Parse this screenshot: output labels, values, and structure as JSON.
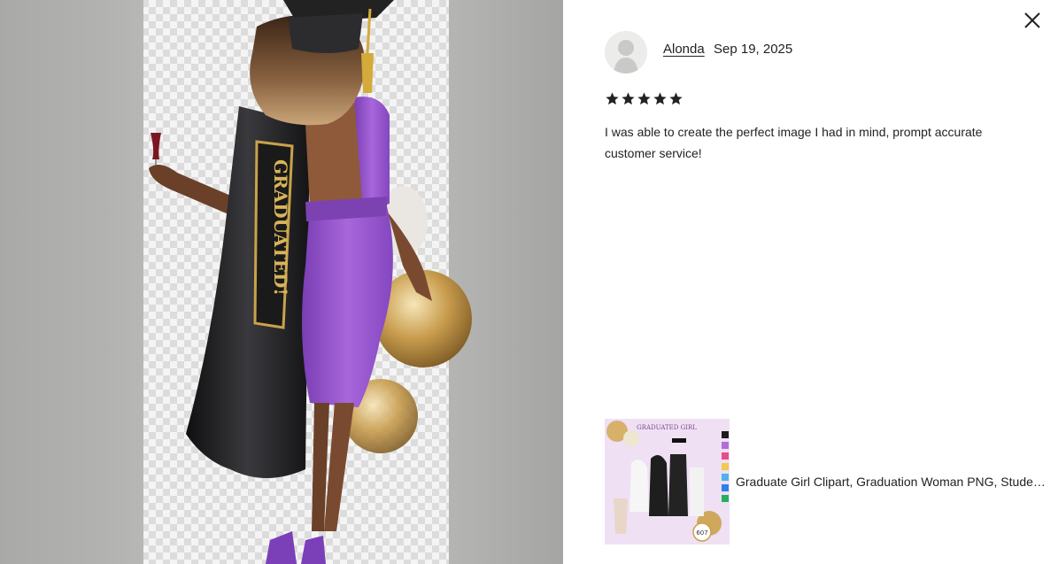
{
  "photo": {
    "sash_text": "GRADUATED!",
    "alt_subject": "graduate-woman-illustration"
  },
  "review": {
    "reviewer_name": "Alonda",
    "date": "Sep 19, 2025",
    "rating": 5,
    "rating_max": 5,
    "text": "I was able to create the perfect image I had in mind, prompt accurate customer service!"
  },
  "listing": {
    "title": "Graduate Girl Clipart, Graduation Woman PNG, Student Clipart",
    "thumb_heading": "GRADUATED GIRL",
    "thumb_badge": "607"
  },
  "icons": {
    "close": "close-icon",
    "star": "star-icon",
    "avatar": "user-avatar-icon"
  },
  "colors": {
    "dress": "#9b5bd0",
    "gown": "#1c1c1e",
    "gold": "#c9a24a",
    "text": "#222222"
  }
}
